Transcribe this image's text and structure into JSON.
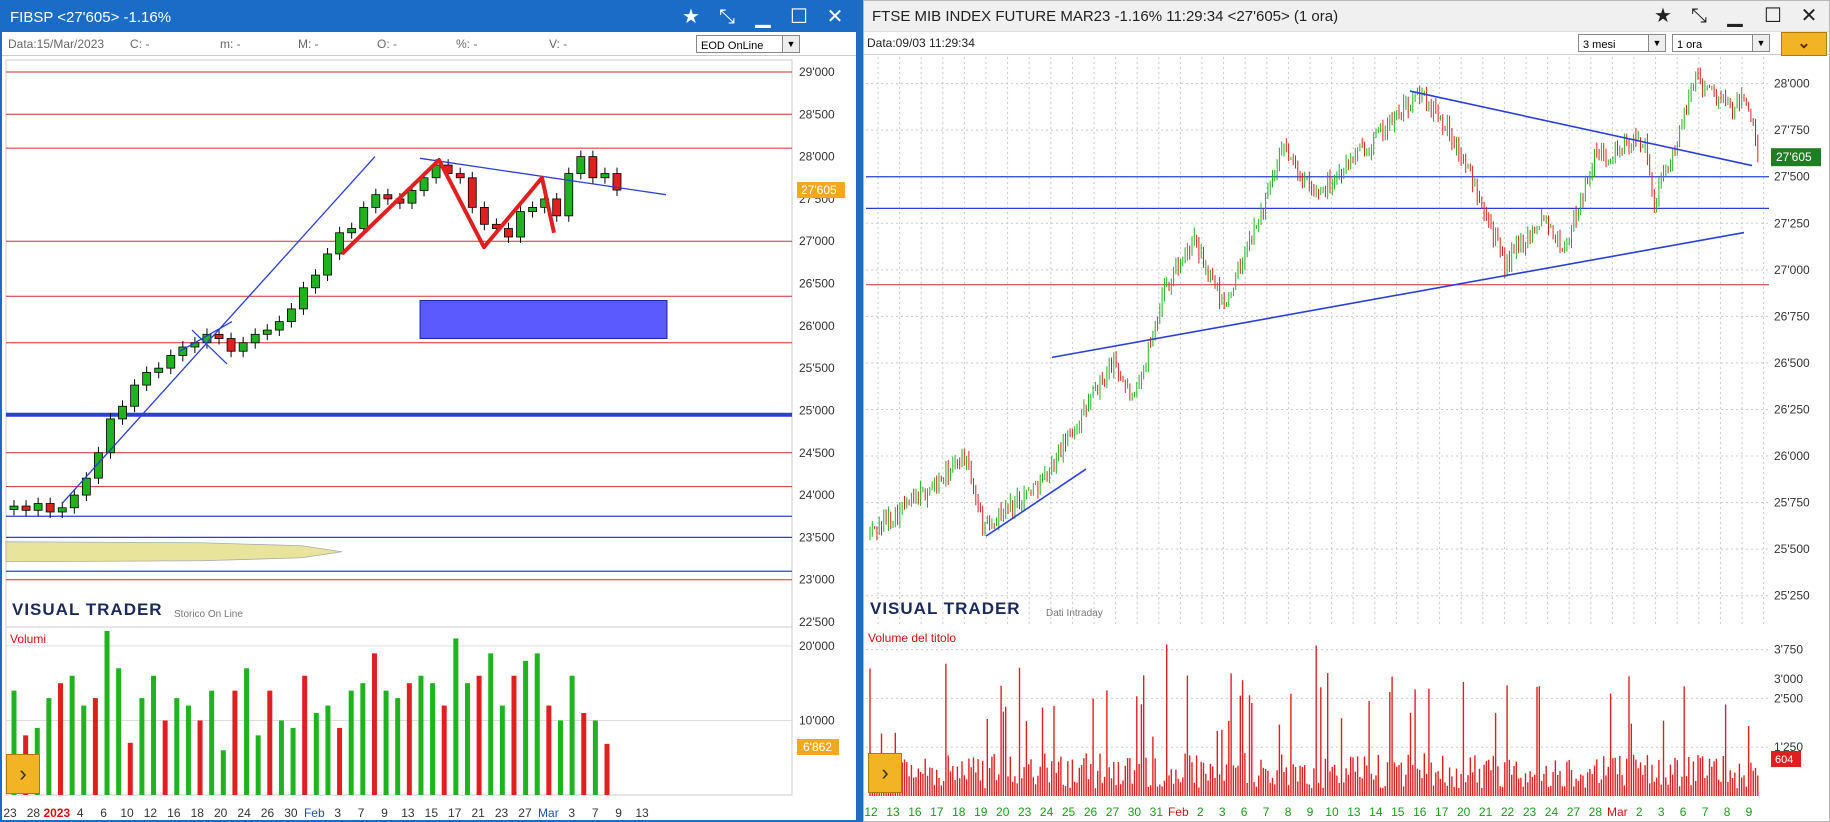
{
  "left_window": {
    "title": "FIBSP <27'605> -1.16%",
    "info": {
      "data": "Data:15/Mar/2023",
      "c": "C: -",
      "m": "m: -",
      "M": "M: -",
      "o": "O: -",
      "pct": "%: -",
      "v": "V: -"
    },
    "source_selected": "EOD OnLine",
    "price_axis": [
      "29'000",
      "28'500",
      "28'000",
      "27'500",
      "27'000",
      "26'500",
      "26'000",
      "25'500",
      "25'000",
      "24'500",
      "24'000",
      "23'500",
      "23'000",
      "22'500"
    ],
    "last_price": "27'605",
    "brand": "VISUAL TRADER",
    "brand_sub": "Storico On Line",
    "volume_label": "Volumi",
    "volume_axis": [
      "20'000",
      "10'000"
    ],
    "last_volume": "6'862",
    "date_axis": [
      "23",
      "28",
      "2023",
      "4",
      "6",
      "10",
      "12",
      "16",
      "18",
      "20",
      "24",
      "26",
      "30",
      "Feb",
      "3",
      "7",
      "9",
      "13",
      "15",
      "17",
      "21",
      "23",
      "27",
      "Mar",
      "3",
      "7",
      "9",
      "13"
    ]
  },
  "right_window": {
    "title": "FTSE MIB INDEX FUTURE MAR23 -1.16% 11:29:34 <27'605> (1 ora)",
    "info": {
      "data": "Data:09/03 11:29:34"
    },
    "period_selected": "3 mesi",
    "interval_selected": "1 ora",
    "price_axis": [
      "28'000",
      "27'750",
      "27'500",
      "27'250",
      "27'000",
      "26'750",
      "26'500",
      "26'250",
      "26'000",
      "25'750",
      "25'500",
      "25'250"
    ],
    "last_price": "27'605",
    "brand": "VISUAL TRADER",
    "brand_sub": "Dati Intraday",
    "volume_label": "Volume del titolo",
    "volume_axis": [
      "3'750",
      "2'500",
      "1'250"
    ],
    "volume_top_tick": "3'000",
    "last_volume": "604",
    "date_axis": [
      "12",
      "13",
      "16",
      "17",
      "18",
      "19",
      "20",
      "23",
      "24",
      "25",
      "26",
      "27",
      "30",
      "31",
      "Feb",
      "2",
      "3",
      "6",
      "7",
      "8",
      "9",
      "10",
      "13",
      "14",
      "15",
      "16",
      "17",
      "20",
      "21",
      "22",
      "23",
      "24",
      "27",
      "28",
      "Mar",
      "2",
      "3",
      "6",
      "7",
      "8",
      "9"
    ]
  },
  "icons": {
    "pin": "star-icon",
    "pencil": "draw-tool-icon",
    "minimize": "minimize-icon",
    "maximize": "maximize-icon",
    "close": "close-icon",
    "dropdown": "chevron-down-icon",
    "go": "play-arrow-icon"
  },
  "colors": {
    "up_candle": "#1fb31f",
    "down_candle": "#e02020",
    "trendline": "#2a3fd8",
    "horizontal_red": "#d42b2b",
    "highlight_zone": "#5a5aff",
    "volume_profile": "#e8e49c",
    "titlebar_active": "#1a6cc6",
    "badge_up": "#1f7d24",
    "badge_orange": "#f2a81d"
  },
  "chart_data": [
    {
      "type": "candlestick",
      "title": "FIBSP",
      "timeframe": "daily",
      "ylim": [
        22500,
        29000
      ],
      "horizontal_levels_red": [
        29000,
        28500,
        28100,
        27000,
        26350,
        25800,
        24500,
        24100,
        23000
      ],
      "horizontal_levels_blue": [
        24950,
        23750,
        23500,
        23100
      ],
      "zone": {
        "y_low": 25850,
        "y_high": 26300,
        "x_from": "15",
        "x_to": "9"
      },
      "series_close": [
        23870,
        23820,
        23900,
        23800,
        23850,
        24000,
        24200,
        24500,
        24900,
        25050,
        25300,
        25450,
        25500,
        25650,
        25750,
        25800,
        25900,
        25850,
        25700,
        25800,
        25900,
        25950,
        26050,
        26200,
        26450,
        26600,
        26850,
        27100,
        27150,
        27400,
        27550,
        27500,
        27450,
        27600,
        27750,
        27900,
        27800,
        27750,
        27400,
        27200,
        27150,
        27050,
        27350,
        27400,
        27500,
        27300,
        27800,
        28000,
        27750,
        27800,
        27605
      ],
      "volume_ylim": [
        0,
        22000
      ],
      "volume": [
        14000,
        8000,
        9000,
        13000,
        15000,
        16000,
        12000,
        13000,
        22000,
        17000,
        7000,
        13000,
        16000,
        10000,
        13000,
        12000,
        10000,
        14000,
        6000,
        14000,
        17000,
        8000,
        14000,
        10000,
        9000,
        16000,
        11000,
        12000,
        9000,
        14000,
        15000,
        19000,
        14000,
        13000,
        15000,
        16000,
        15000,
        12000,
        21000,
        15000,
        16000,
        19000,
        12000,
        16000,
        18000,
        19000,
        12000,
        10000,
        16000,
        11000,
        10000,
        6862
      ]
    },
    {
      "type": "candlestick",
      "title": "FTSE MIB INDEX FUTURE MAR23",
      "timeframe": "1 ora",
      "ylim": [
        25125,
        28100
      ],
      "horizontal_levels_blue": [
        27500,
        27330
      ],
      "horizontal_levels_red": [
        26920
      ],
      "volume_ylim": [
        0,
        4200
      ]
    }
  ]
}
